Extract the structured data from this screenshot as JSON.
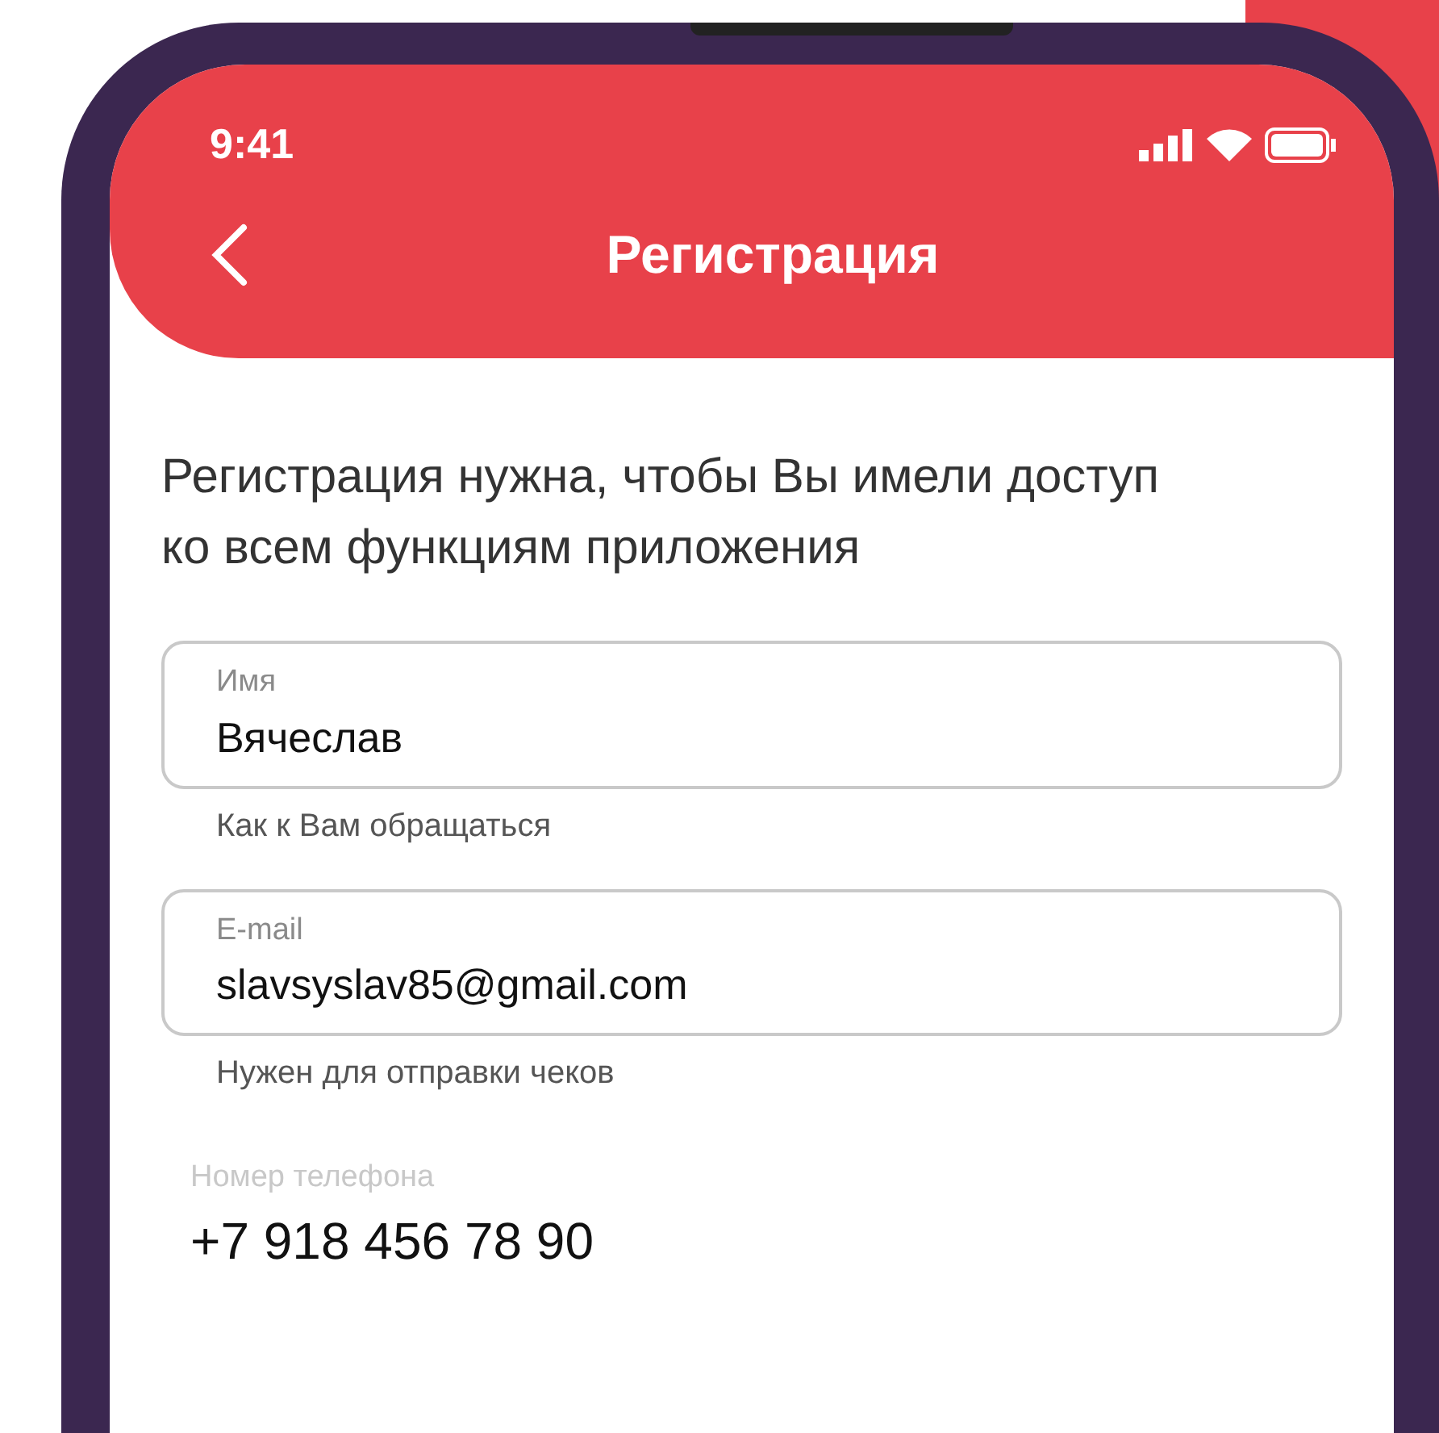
{
  "status_bar": {
    "time": "9:41"
  },
  "header": {
    "title": "Регистрация"
  },
  "intro": "Регистрация нужна, чтобы Вы имели доступ ко всем функциям приложения",
  "fields": [
    {
      "kind": "outlined",
      "label": "Имя",
      "value": "Вячеслав",
      "helper": "Как к Вам обращаться"
    },
    {
      "kind": "outlined",
      "label": "E-mail",
      "value": "slavsyslav85@gmail.com",
      "helper": "Нужен для отправки чеков"
    },
    {
      "kind": "plain",
      "label": "Номер телефона",
      "value": "+7 918 456 78 90"
    }
  ]
}
